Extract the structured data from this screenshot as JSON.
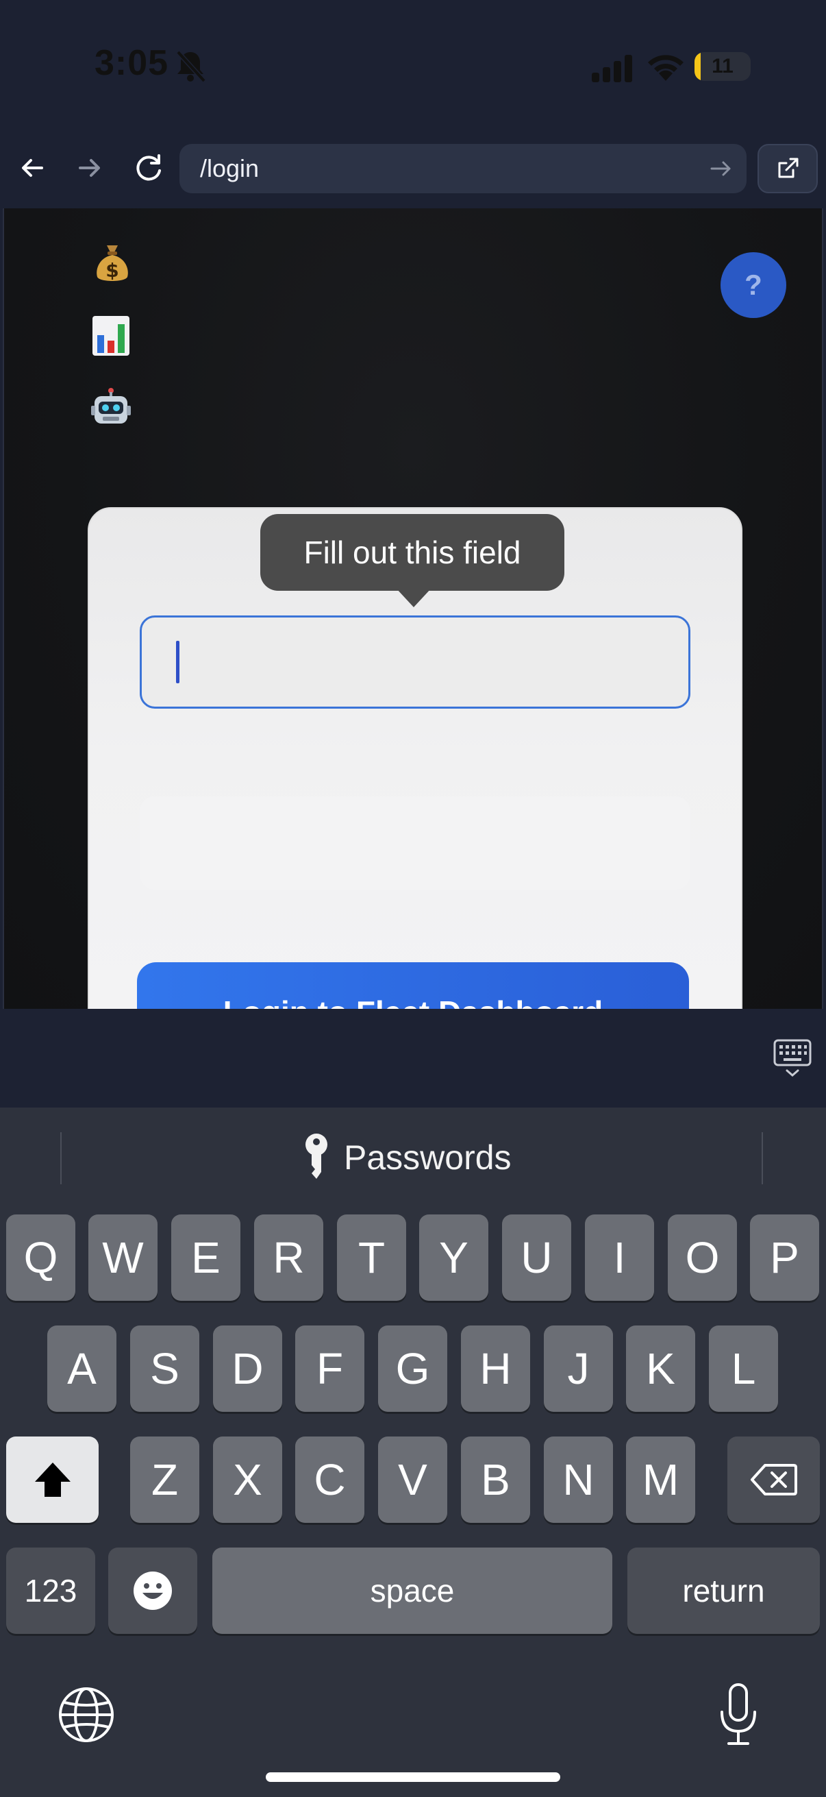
{
  "status_bar": {
    "time": "3:05",
    "battery_level": "11",
    "battery_fraction": 0.11
  },
  "browser": {
    "url": "/login"
  },
  "page": {
    "side_icons": [
      "💰",
      "📊",
      "🤖"
    ],
    "help_label": "?",
    "tooltip": "Fill out this field",
    "login_button_label": "Login to Fleet Dashboard"
  },
  "keyboard": {
    "passwords_label": "Passwords",
    "row1": [
      "Q",
      "W",
      "E",
      "R",
      "T",
      "Y",
      "U",
      "I",
      "O",
      "P"
    ],
    "row2": [
      "A",
      "S",
      "D",
      "F",
      "G",
      "H",
      "J",
      "K",
      "L"
    ],
    "row3": [
      "Z",
      "X",
      "C",
      "V",
      "B",
      "N",
      "M"
    ],
    "numbers_label": "123",
    "space_label": "space",
    "return_label": "return"
  }
}
